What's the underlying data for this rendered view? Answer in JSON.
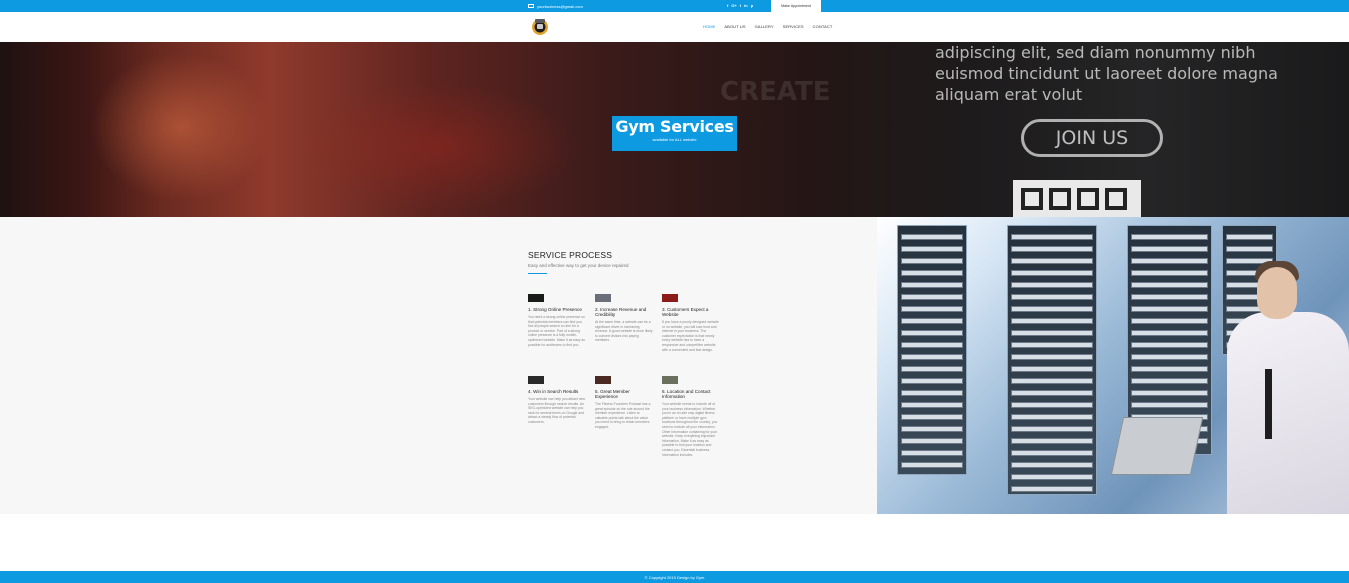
{
  "topbar": {
    "email": "yourbusiness@gmail.com",
    "socials": [
      {
        "icon": "facebook-icon",
        "glyph": "f"
      },
      {
        "icon": "google-plus-icon",
        "glyph": "G+"
      },
      {
        "icon": "twitter-icon",
        "glyph": "t"
      },
      {
        "icon": "linkedin-icon",
        "glyph": "in"
      },
      {
        "icon": "pinterest-icon",
        "glyph": "p"
      }
    ],
    "appointment_label": "Make Appointment"
  },
  "nav": {
    "items": [
      {
        "label": "HOME",
        "active": true
      },
      {
        "label": "ABOUT US",
        "active": false
      },
      {
        "label": "GALLERY",
        "active": false
      },
      {
        "label": "SERVICES",
        "active": false
      },
      {
        "label": "CONTACT",
        "active": false
      }
    ]
  },
  "hero": {
    "title": "Gym Services",
    "subtitle": "available for ALL website",
    "background_text_1": "adipiscing elit, sed diam nonummy nibh",
    "background_text_2": "euismod tincidunt ut laoreet dolore magna",
    "background_text_3": "aliquam erat volut",
    "background_button": "JOIN US"
  },
  "service_process": {
    "heading": "SERVICE PROCESS",
    "subheading": "Easy and effective way to get your device repaired",
    "items": [
      {
        "title": "1. Strong Online Presence",
        "description": "You need a strong online presence so that potential members can find you. Not all people search on-line for a product or service. Part of a strong online presence is a fully mobile-optimized website. Make it as easy as possible for audiences to find you."
      },
      {
        "title": "2. Increase Revenue and Credibility",
        "description": "At the same time, a website can be a significant driver in increasing revenue. A good website is more likely to convert visitors into paying members."
      },
      {
        "title": "3. Customers Expect a Website",
        "description": "If you have a poorly designed website or no website, you will lose trust and interest in your business. The customer expectation is that nearly every website has to have a responsive and competitive website with a convenient and fast design."
      },
      {
        "title": "4. Win in Search Results",
        "description": "Your website can help you attract new customers through search results. An SEO-optimized website can help you rank for several terms on Google and attract a steady flow of potential customers."
      },
      {
        "title": "5. Great Member Experience",
        "description": "The Fitness Founders Podcast has a great episode on the role around the member experience. Listen to valuable points talk about the value you need to bring to retain members engaged."
      },
      {
        "title": "6. Location and Contact Information",
        "description": "Your website needs to include all of your business information. Whether you're an on-site only digital fitness platform or have multiple gym locations throughout the country, you need to include all your information. Other information containing for your website. Keep everything important information. Make it as easy as possible to find your location and contact you. Essential business information includes."
      }
    ]
  },
  "footer": {
    "text": "© Copyright 2019 Design by Gym"
  },
  "colors": {
    "accent": "#0d9ae0",
    "section_bg": "#f7f7f7"
  }
}
